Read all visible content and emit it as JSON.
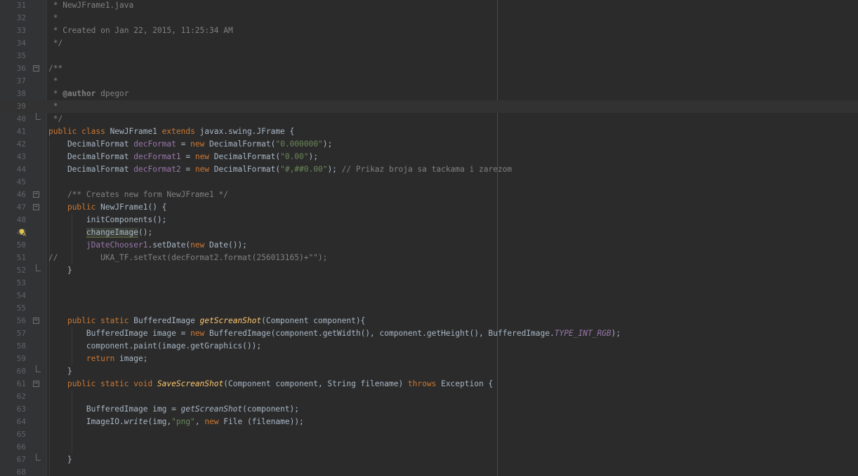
{
  "editor": {
    "file": "NewJFrame1.java",
    "current_line": 39,
    "lines": [
      {
        "n": "31",
        "indent": 0,
        "tokens": [
          {
            "t": " * NewJFrame1.java",
            "c": "cm"
          }
        ]
      },
      {
        "n": "32",
        "indent": 0,
        "tokens": [
          {
            "t": " *",
            "c": "cm"
          }
        ]
      },
      {
        "n": "33",
        "indent": 0,
        "tokens": [
          {
            "t": " * Created on Jan 22, 2015, 11:25:34 AM",
            "c": "cm"
          }
        ]
      },
      {
        "n": "34",
        "indent": 0,
        "tokens": [
          {
            "t": " */",
            "c": "cm"
          }
        ]
      },
      {
        "n": "35",
        "indent": 0,
        "tokens": []
      },
      {
        "n": "36",
        "indent": 0,
        "fold": "open",
        "tokens": [
          {
            "t": "/**",
            "c": "cm"
          }
        ]
      },
      {
        "n": "37",
        "indent": 0,
        "tokens": [
          {
            "t": " *",
            "c": "cm"
          }
        ]
      },
      {
        "n": "38",
        "indent": 0,
        "tokens": [
          {
            "t": " * ",
            "c": "cm"
          },
          {
            "t": "@author",
            "c": "doctag"
          },
          {
            "t": " dpegor",
            "c": "cm"
          }
        ]
      },
      {
        "n": "39",
        "indent": 0,
        "current": true,
        "tokens": [
          {
            "t": " *",
            "c": "cm"
          }
        ]
      },
      {
        "n": "40",
        "indent": 0,
        "fold": "end",
        "tokens": [
          {
            "t": " */",
            "c": "cm"
          }
        ]
      },
      {
        "n": "41",
        "indent": 0,
        "tokens": [
          {
            "t": "public class ",
            "c": "kw"
          },
          {
            "t": "NewJFrame1 "
          },
          {
            "t": "extends ",
            "c": "kw"
          },
          {
            "t": "javax.swing.JFrame {"
          }
        ]
      },
      {
        "n": "42",
        "indent": 1,
        "tokens": [
          {
            "t": "    DecimalFormat "
          },
          {
            "t": "decFormat",
            "c": "fd"
          },
          {
            "t": " = "
          },
          {
            "t": "new ",
            "c": "kw"
          },
          {
            "t": "DecimalFormat("
          },
          {
            "t": "\"0.000000\"",
            "c": "st"
          },
          {
            "t": ");"
          }
        ]
      },
      {
        "n": "43",
        "indent": 1,
        "tokens": [
          {
            "t": "    DecimalFormat "
          },
          {
            "t": "decFormat1",
            "c": "fd"
          },
          {
            "t": " = "
          },
          {
            "t": "new ",
            "c": "kw"
          },
          {
            "t": "DecimalFormat("
          },
          {
            "t": "\"0.00\"",
            "c": "st"
          },
          {
            "t": ");"
          }
        ]
      },
      {
        "n": "44",
        "indent": 1,
        "tokens": [
          {
            "t": "    DecimalFormat "
          },
          {
            "t": "decFormat2",
            "c": "fd"
          },
          {
            "t": " = "
          },
          {
            "t": "new ",
            "c": "kw"
          },
          {
            "t": "DecimalFormat("
          },
          {
            "t": "\"#,##0.00\"",
            "c": "st"
          },
          {
            "t": "); "
          },
          {
            "t": "// Prikaz broja sa tackama i zarezom",
            "c": "cm"
          }
        ]
      },
      {
        "n": "45",
        "indent": 1,
        "tokens": []
      },
      {
        "n": "46",
        "indent": 1,
        "fold": "open",
        "tokens": [
          {
            "t": "    /** Creates new form NewJFrame1 */",
            "c": "cm"
          }
        ]
      },
      {
        "n": "47",
        "indent": 1,
        "fold": "open",
        "tokens": [
          {
            "t": "    "
          },
          {
            "t": "public ",
            "c": "kw"
          },
          {
            "t": "NewJFrame1() {"
          }
        ]
      },
      {
        "n": "48",
        "indent": 2,
        "tokens": [
          {
            "t": "        initComponents();"
          }
        ]
      },
      {
        "n": "49",
        "indent": 2,
        "bulb": true,
        "tokens": [
          {
            "t": "        "
          },
          {
            "t": "changeImage",
            "c": "hl"
          },
          {
            "t": "();"
          }
        ]
      },
      {
        "n": "50",
        "indent": 2,
        "tokens": [
          {
            "t": "        "
          },
          {
            "t": "jDateChooser1",
            "c": "fd"
          },
          {
            "t": ".setDate("
          },
          {
            "t": "new ",
            "c": "kw"
          },
          {
            "t": "Date());"
          }
        ]
      },
      {
        "n": "51",
        "indent": 2,
        "tokens": [
          {
            "t": "//         UKA_TF.setText(decFormat2.format(256013165)+\"\");",
            "c": "cm"
          }
        ]
      },
      {
        "n": "52",
        "indent": 1,
        "fold": "end",
        "tokens": [
          {
            "t": "    }"
          }
        ]
      },
      {
        "n": "53",
        "indent": 1,
        "tokens": []
      },
      {
        "n": "54",
        "indent": 1,
        "tokens": []
      },
      {
        "n": "55",
        "indent": 1,
        "tokens": []
      },
      {
        "n": "56",
        "indent": 1,
        "fold": "open",
        "tokens": [
          {
            "t": "    "
          },
          {
            "t": "public static ",
            "c": "kw"
          },
          {
            "t": "BufferedImage "
          },
          {
            "t": "getScreanShot",
            "c": "mc"
          },
          {
            "t": "(Component component){"
          }
        ]
      },
      {
        "n": "57",
        "indent": 2,
        "tokens": [
          {
            "t": "        BufferedImage image = "
          },
          {
            "t": "new ",
            "c": "kw"
          },
          {
            "t": "BufferedImage(component.getWidth(), component.getHeight(), BufferedImage."
          },
          {
            "t": "TYPE_INT_RGB",
            "c": "st-i"
          },
          {
            "t": ");"
          }
        ]
      },
      {
        "n": "58",
        "indent": 2,
        "tokens": [
          {
            "t": "        component.paint(image.getGraphics());"
          }
        ]
      },
      {
        "n": "59",
        "indent": 2,
        "tokens": [
          {
            "t": "        "
          },
          {
            "t": "return ",
            "c": "kw"
          },
          {
            "t": "image;"
          }
        ]
      },
      {
        "n": "60",
        "indent": 1,
        "fold": "end",
        "tokens": [
          {
            "t": "    }"
          }
        ]
      },
      {
        "n": "61",
        "indent": 1,
        "fold": "open",
        "tokens": [
          {
            "t": "    "
          },
          {
            "t": "public static void ",
            "c": "kw"
          },
          {
            "t": "SaveScreanShot",
            "c": "mc"
          },
          {
            "t": "(Component component, String filename) "
          },
          {
            "t": "throws ",
            "c": "kw"
          },
          {
            "t": "Exception {"
          }
        ]
      },
      {
        "n": "62",
        "indent": 2,
        "tokens": []
      },
      {
        "n": "63",
        "indent": 2,
        "tokens": [
          {
            "t": "        BufferedImage img = "
          },
          {
            "t": "getScreanShot",
            "c": "sm"
          },
          {
            "t": "(component);"
          }
        ]
      },
      {
        "n": "64",
        "indent": 2,
        "tokens": [
          {
            "t": "        ImageIO."
          },
          {
            "t": "write",
            "c": "sm"
          },
          {
            "t": "(img,"
          },
          {
            "t": "\"png\"",
            "c": "st"
          },
          {
            "t": ", "
          },
          {
            "t": "new ",
            "c": "kw"
          },
          {
            "t": "File (filename));"
          }
        ]
      },
      {
        "n": "65",
        "indent": 2,
        "tokens": []
      },
      {
        "n": "66",
        "indent": 2,
        "tokens": []
      },
      {
        "n": "67",
        "indent": 1,
        "fold": "end",
        "tokens": [
          {
            "t": "    }"
          }
        ]
      },
      {
        "n": "68",
        "indent": 1,
        "tokens": []
      }
    ]
  }
}
